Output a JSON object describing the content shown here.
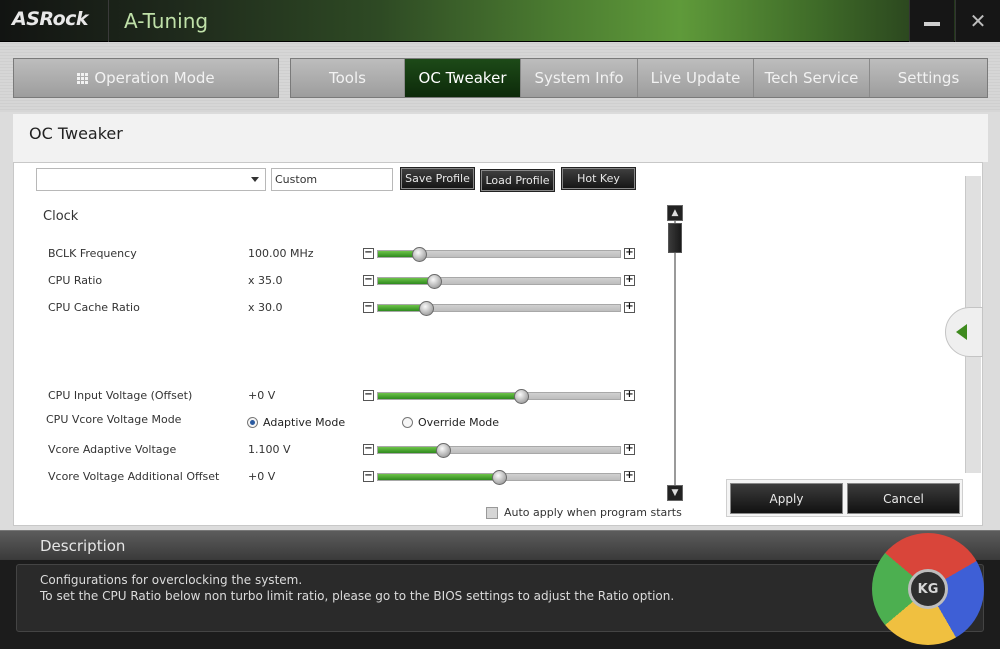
{
  "app": {
    "brand": "ASRock",
    "title": "A-Tuning"
  },
  "window": {
    "minimize_label": "—",
    "close_label": "✕"
  },
  "nav": {
    "operation_mode": "Operation Mode",
    "tabs": [
      {
        "label": "Tools"
      },
      {
        "label": "OC Tweaker",
        "active": true
      },
      {
        "label": "System Info"
      },
      {
        "label": "Live Update"
      },
      {
        "label": "Tech Service"
      },
      {
        "label": "Settings"
      }
    ]
  },
  "page": {
    "title": "OC Tweaker"
  },
  "profile": {
    "selected": "",
    "name_value": "Custom",
    "save_label": "Save Profile",
    "load_label": "Load Profile",
    "hotkey_label": "Hot Key"
  },
  "clock": {
    "section_label": "Clock",
    "rows": [
      {
        "label": "BCLK Frequency",
        "value": "100.00 MHz",
        "level": 0.17
      },
      {
        "label": "CPU Ratio",
        "value": "x 35.0",
        "level": 0.23
      },
      {
        "label": "CPU Cache Ratio",
        "value": "x 30.0",
        "level": 0.2
      }
    ]
  },
  "voltage": {
    "input_offset": {
      "label": "CPU Input Voltage (Offset)",
      "value": "+0 V",
      "level": 0.59
    },
    "vcore_mode": {
      "label": "CPU Vcore Voltage Mode",
      "adaptive": "Adaptive Mode",
      "override": "Override Mode",
      "selected": "adaptive"
    },
    "adaptive_voltage": {
      "label": "Vcore Adaptive Voltage",
      "value": "1.100 V",
      "level": 0.27
    },
    "additional_offset": {
      "label": "Vcore Voltage Additional Offset",
      "value": "+0 V",
      "level": 0.5
    }
  },
  "footer": {
    "auto_apply_label": "Auto apply when program starts",
    "apply_label": "Apply",
    "cancel_label": "Cancel"
  },
  "description": {
    "header": "Description",
    "line1": "Configurations for overclocking the system.",
    "line2": "To set the CPU Ratio below non turbo limit ratio, please go to the BIOS settings to adjust the Ratio option."
  },
  "watermark": {
    "text": "KG"
  },
  "colors": {
    "accent_green": "#2e8a1e",
    "active_tab": "#123a10",
    "title_bar": "#121412"
  }
}
